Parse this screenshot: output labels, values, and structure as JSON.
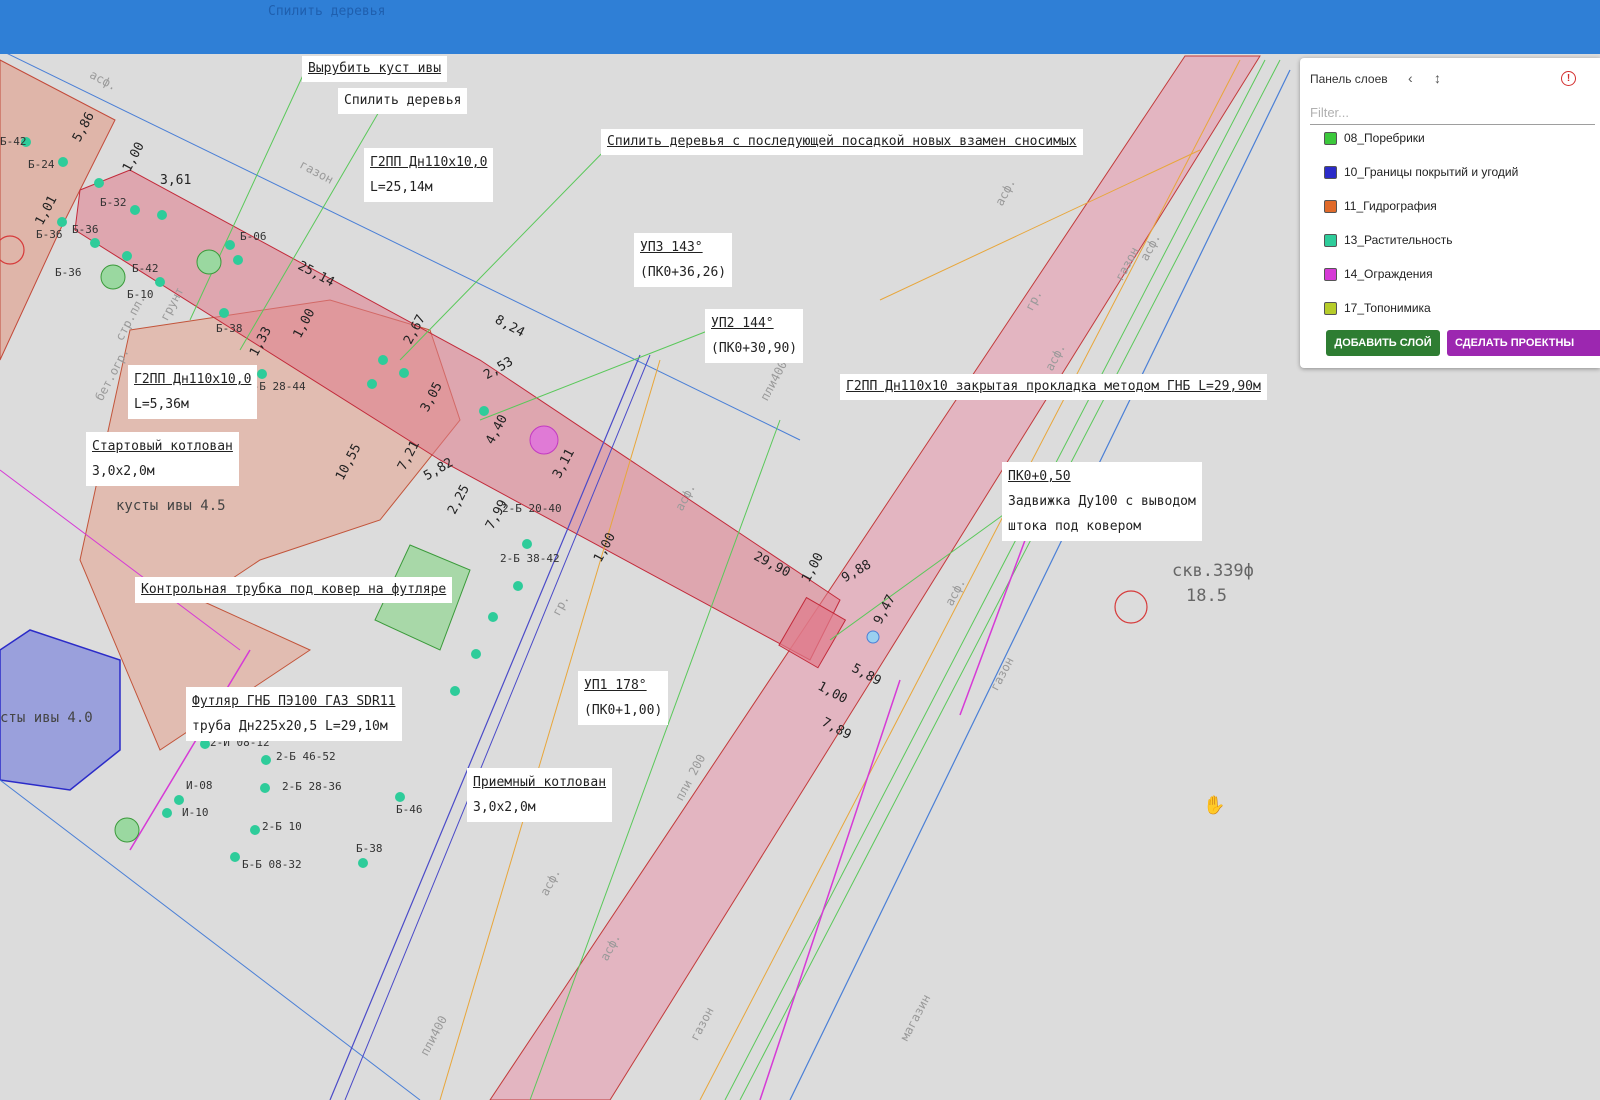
{
  "topbar": {
    "color": "#2f7fd6"
  },
  "map": {
    "faded_top_label": "Спилить деревья",
    "labels": {
      "cut_bush": "Вырубить куст ивы",
      "saw_trees": "Спилить деревья",
      "saw_replant": "Спилить деревья с последующей посадкой новых взамен сносимых",
      "g2pp1_title": "Г2ПП Дн110х10,0",
      "g2pp1_len": "L=25,14м",
      "up3_title": "УП3 143°",
      "up3_pk": "(ПК0+36,26)",
      "up2_title": "УП2 144°",
      "up2_pk": "(ПК0+30,90)",
      "g2pp_gnb": "Г2ПП Дн110х10 закрытая прокладка методом ГНБ L=29,90м",
      "g2pp2_title": "Г2ПП Дн110х10,0",
      "g2pp2_len": "L=5,36м",
      "start_pit": "Стартовый котлован",
      "start_pit_size": "3,0х2,0м",
      "pk050": "ПК0+0,50",
      "valve1": "Задвижка Ду100 с выводом",
      "valve2": "штока под ковером",
      "control_tube": "Контрольная трубка под ковер на футляре",
      "case1": "Футляр ГНБ ПЭ100 ГАЗ SDR11",
      "case2": "труба Дн225х20,5 L=29,10м",
      "up1_title": "УП1 178°",
      "up1_pk": "(ПК0+1,00)",
      "recv_pit": "Приемный котлован",
      "recv_pit_size": "3,0х2,0м"
    },
    "free_text": {
      "willow45": "кусты ивы 4.5",
      "willow40": "сты ивы 4.0",
      "well1": "скв.339ф",
      "well2": "18.5"
    },
    "dimensions": [
      "5,86",
      "1,00",
      "3,61",
      "1,01",
      "25,14",
      "8,24",
      "2,67",
      "2,53",
      "1,00",
      "1,33",
      "4,40",
      "3,05",
      "10,55",
      "7,21",
      "5,82",
      "2,25",
      "7,99",
      "3,11",
      "1,00",
      "29,90",
      "1,00",
      "9,88",
      "9,47",
      "5,89",
      "1,00",
      "7,89"
    ],
    "tree_tags": [
      "Б-42",
      "Б-24",
      "Б-32",
      "Б-36",
      "Б-36",
      "Б-06",
      "Б-42",
      "Б-10",
      "Б-36",
      "Б-38",
      "2-Б 28-44",
      "2-Б 20-40",
      "2-Б 38-42",
      "2-Б 46-52",
      "2-Б 28-36",
      "2-Б 10",
      "Б-46",
      "Б-38",
      "Б-Б 08-32",
      "И-08",
      "И-10",
      "2-И 08-12"
    ],
    "surface_labels": [
      "асф.",
      "газон",
      "асф.",
      "газон",
      "асф.",
      "гр.",
      "асф.",
      "асф.",
      "газон",
      "гр.",
      "асф.",
      "асф.",
      "пли400",
      "пли400",
      "пли 200",
      "газон",
      "асф.",
      "грунт",
      "бет.огр.",
      "стр.пл.",
      "магазин"
    ]
  },
  "panel": {
    "title": "Панель слоев",
    "collapse_icon": "chevron-left-icon",
    "resize_icon": "arrows-vertical-icon",
    "warning_icon": "warning-circle-icon",
    "filter_placeholder": "Filter...",
    "layers": [
      {
        "name": "08_Поребрики",
        "color": "#3cc83c"
      },
      {
        "name": "10_Границы покрытий и угодий",
        "color": "#2b2bc8"
      },
      {
        "name": "11_Гидрография",
        "color": "#e06a2a"
      },
      {
        "name": "13_Растительность",
        "color": "#2ecc9a"
      },
      {
        "name": "14_Ограждения",
        "color": "#d63ad6"
      },
      {
        "name": "17_Топонимика",
        "color": "#b6cc2a"
      }
    ],
    "add_layer": "ДОБАВИТЬ СЛОЙ",
    "make_project": "СДЕЛАТЬ ПРОЕКТНЫ",
    "add_color": "#2e7d32",
    "project_color": "#9c27b0"
  }
}
